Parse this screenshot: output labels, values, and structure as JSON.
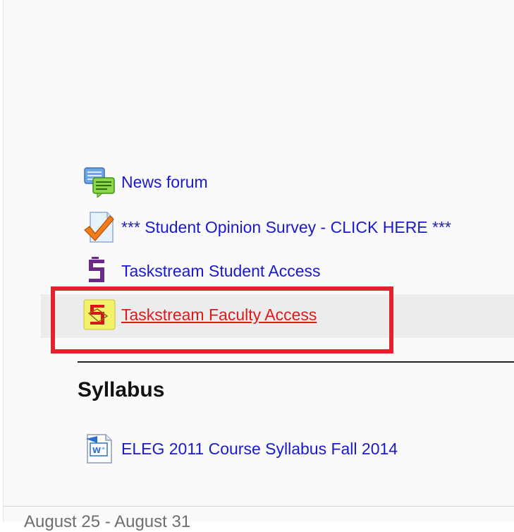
{
  "section_activities": [
    {
      "label": "News forum",
      "icon": "forum-icon"
    },
    {
      "label": "*** Student Opinion Survey - CLICK HERE ***",
      "icon": "survey-checkmark-icon"
    },
    {
      "label": "Taskstream Student Access",
      "icon": "taskstream-icon"
    },
    {
      "label": "Taskstream Faculty Access",
      "icon": "taskstream-faculty-icon"
    }
  ],
  "syllabus_section": {
    "title": "Syllabus",
    "items": [
      {
        "label": "ELEG 2011 Course Syllabus Fall 2014",
        "icon": "word-document-icon"
      }
    ]
  },
  "next_section": {
    "title": "August 25 - August 31"
  },
  "colors": {
    "link": "#1a1acc",
    "hover_link": "#e01919",
    "highlight_box": "#e0232d",
    "hover_row_bg": "#ececec"
  }
}
